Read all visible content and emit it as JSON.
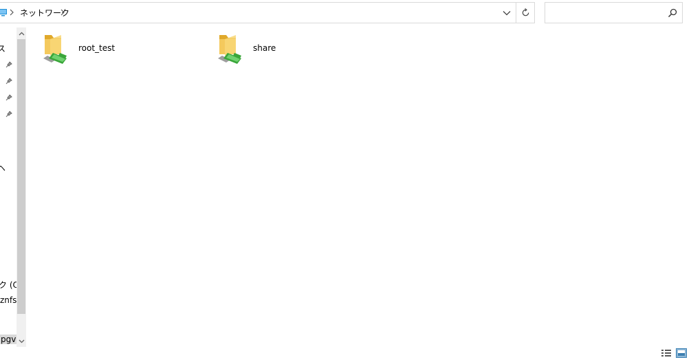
{
  "address_bar": {
    "breadcrumb": "ネットワーク",
    "icons": [
      "pc-icon",
      "chevron-right-icon",
      "chevron-down-icon",
      "refresh-icon"
    ]
  },
  "search": {
    "value": "",
    "placeholder": "",
    "icon": "search-icon"
  },
  "nav_pane": {
    "clipped_labels": [
      "ス",
      "ヘ",
      "ク (C",
      "znfs:",
      "pgv"
    ],
    "pinned_icon": "pin-icon",
    "pinned_count": 4
  },
  "items": [
    {
      "label": "root_test",
      "icon": "network-share-folder-icon"
    },
    {
      "label": "share",
      "icon": "network-share-folder-icon"
    }
  ],
  "status_bar": {
    "icons": [
      "details-view-icon",
      "large-icons-view-icon"
    ]
  },
  "colors": {
    "folder_yellow": "#f4c95d",
    "folder_dark": "#e0a92b",
    "share_green": "#3aa63a",
    "border": "#d9d9d9",
    "scrollbar_thumb": "#cdcdcd",
    "selection": "#cce8ff"
  }
}
